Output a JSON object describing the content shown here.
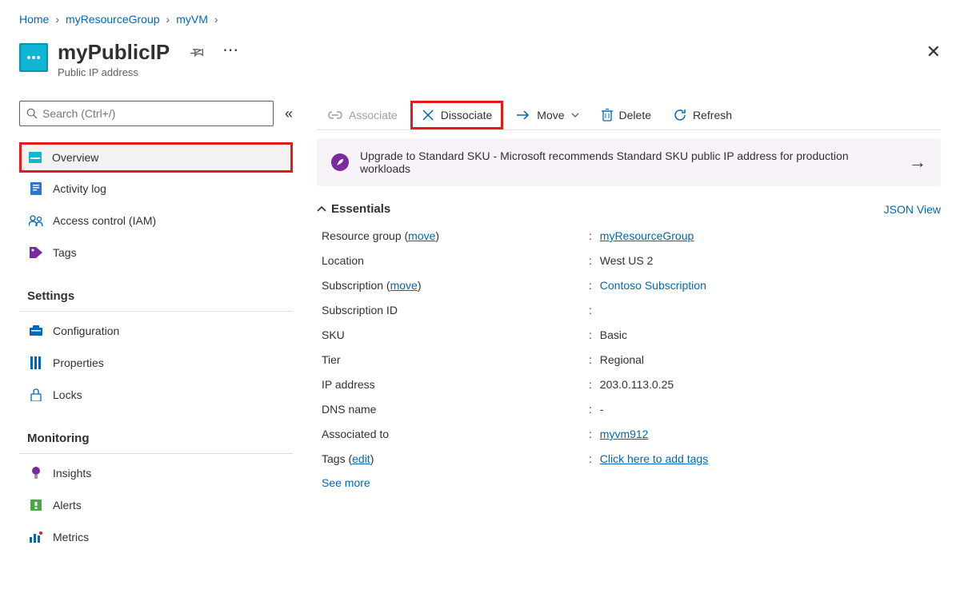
{
  "breadcrumb": [
    {
      "label": "Home"
    },
    {
      "label": "myResourceGroup"
    },
    {
      "label": "myVM"
    }
  ],
  "header": {
    "title": "myPublicIP",
    "subtitle": "Public IP address"
  },
  "search": {
    "placeholder": "Search (Ctrl+/)"
  },
  "nav": {
    "top": [
      {
        "label": "Overview"
      },
      {
        "label": "Activity log"
      },
      {
        "label": "Access control (IAM)"
      },
      {
        "label": "Tags"
      }
    ],
    "settings_heading": "Settings",
    "settings": [
      {
        "label": "Configuration"
      },
      {
        "label": "Properties"
      },
      {
        "label": "Locks"
      }
    ],
    "monitoring_heading": "Monitoring",
    "monitoring": [
      {
        "label": "Insights"
      },
      {
        "label": "Alerts"
      },
      {
        "label": "Metrics"
      }
    ]
  },
  "toolbar": {
    "associate": "Associate",
    "dissociate": "Dissociate",
    "move": "Move",
    "delete": "Delete",
    "refresh": "Refresh"
  },
  "banner": {
    "text": "Upgrade to Standard SKU - Microsoft recommends Standard SKU public IP address for production workloads"
  },
  "essentials": {
    "heading": "Essentials",
    "json_view": "JSON View",
    "rows": [
      {
        "label": "Resource group (",
        "link_paren": "move",
        "value_link": "myResourceGroup"
      },
      {
        "label": "Location",
        "value": "West US 2"
      },
      {
        "label": "Subscription (",
        "link_paren": "move",
        "value_link_nound": "Contoso Subscription"
      },
      {
        "label": "Subscription ID",
        "value": ""
      },
      {
        "label": "SKU",
        "value": "Basic"
      },
      {
        "label": "Tier",
        "value": "Regional"
      },
      {
        "label": "IP address",
        "value": "203.0.113.0.25"
      },
      {
        "label": "DNS name",
        "value": "-"
      },
      {
        "label": "Associated to",
        "value_link": "myvm912"
      },
      {
        "label": "Tags (",
        "link_paren": "edit",
        "value_link": "Click here to add tags"
      }
    ],
    "see_more": "See more"
  }
}
